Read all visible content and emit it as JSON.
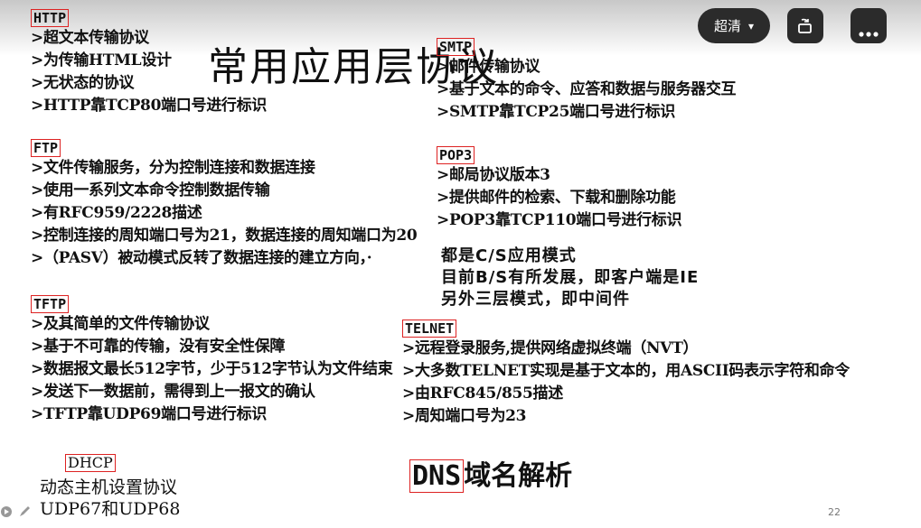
{
  "controls": {
    "quality_label": "超清",
    "quality_caret": "▾"
  },
  "slide": {
    "title": "常用应用层协议",
    "page_number": "22",
    "http": {
      "name": "HTTP",
      "lines": [
        ">超文本传输协议",
        ">为传输HTML设计",
        ">无状态的协议",
        ">HTTP靠TCP80端口号进行标识"
      ]
    },
    "ftp": {
      "name": "FTP",
      "lines": [
        ">文件传输服务，分为控制连接和数据连接",
        ">使用一系列文本命令控制数据传输",
        ">有RFC959/2228描述",
        ">控制连接的周知端口号为21，数据连接的周知端口为20",
        ">（PASV）被动模式反转了数据连接的建立方向，·"
      ]
    },
    "tftp": {
      "name": "TFTP",
      "lines": [
        ">及其简单的文件传输协议",
        ">基于不可靠的传输，没有安全性保障",
        ">数据报文最长512字节，少于512字节认为文件结束",
        ">发送下一数据前，需得到上一报文的确认",
        ">TFTP靠UDP69端口号进行标识"
      ]
    },
    "dhcp": {
      "name": "DHCP",
      "lines": [
        "动态主机设置协议",
        "UDP67和UDP68"
      ]
    },
    "smtp": {
      "name": "SMTP",
      "lines": [
        ">邮件传输协议",
        ">基于文本的命令、应答和数据与服务器交互",
        ">SMTP靠TCP25端口号进行标识"
      ]
    },
    "pop3": {
      "name": "POP3",
      "lines": [
        ">邮局协议版本3",
        ">提供邮件的检索、下载和删除功能",
        ">POP3靠TCP110端口号进行标识"
      ]
    },
    "cs_notes": [
      "都是C/S应用模式",
      "目前B/S有所发展，即客户端是IE",
      "另外三层模式，即中间件"
    ],
    "telnet": {
      "name": "TELNET",
      "lines": [
        ">远程登录服务,提供网络虚拟终端（NVT）",
        ">大多数TELNET实现是基于文本的，用ASCII码表示字符和命令",
        ">由RFC845/855描述",
        ">周知端口号为23"
      ]
    },
    "dns": {
      "name": "DNS",
      "label": "域名解析"
    }
  }
}
